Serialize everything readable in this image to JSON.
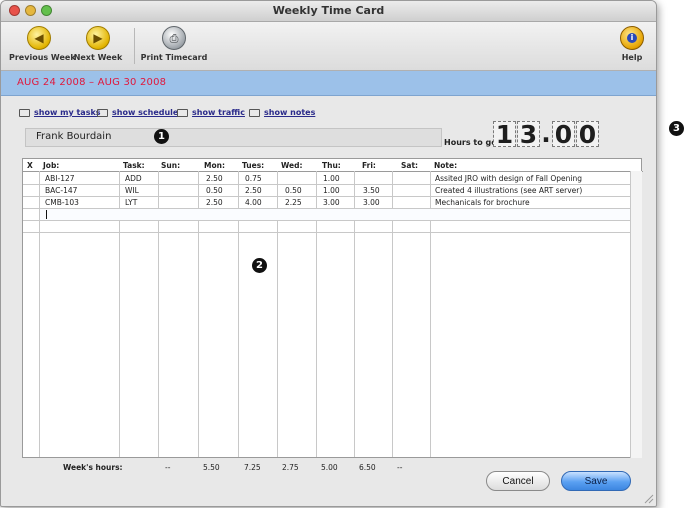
{
  "window": {
    "title": "Weekly Time Card"
  },
  "toolbar": {
    "previous_week": "Previous Week",
    "next_week": "Next Week",
    "print_timecard": "Print Timecard",
    "help": "Help"
  },
  "date_range": "AUG 24 2008 – AUG 30 2008",
  "links": {
    "show_my_tasks": "show my tasks",
    "show_schedule": "show schedule",
    "show_traffic": "show traffic",
    "show_notes": "show notes"
  },
  "employee_name": "Frank Bourdain",
  "hours_to_go": {
    "label": "Hours to go:",
    "digits": [
      "1",
      "3",
      ".",
      "0",
      "0"
    ]
  },
  "callouts": [
    "1",
    "2",
    "3"
  ],
  "table": {
    "headers": [
      "X",
      "Job:",
      "Task:",
      "Sun:",
      "Mon:",
      "Tues:",
      "Wed:",
      "Thu:",
      "Fri:",
      "Sat:",
      "Note:"
    ],
    "rows": [
      {
        "x": "",
        "job": "ABI-127",
        "task": "ADD",
        "sun": "",
        "mon": "2.50",
        "tues": "0.75",
        "wed": "",
        "thu": "1.00",
        "fri": "",
        "sat": "",
        "note": "Assited JRO with design of Fall Opening"
      },
      {
        "x": "",
        "job": "BAC-147",
        "task": "WIL",
        "sun": "",
        "mon": "0.50",
        "tues": "2.50",
        "wed": "0.50",
        "thu": "1.00",
        "fri": "3.50",
        "sat": "",
        "note": "Created 4 illustrations (see ART server)"
      },
      {
        "x": "",
        "job": "CMB-103",
        "task": "LYT",
        "sun": "",
        "mon": "2.50",
        "tues": "4.00",
        "wed": "2.25",
        "thu": "3.00",
        "fri": "3.00",
        "sat": "",
        "note": "Mechanicals for brochure"
      }
    ]
  },
  "weeks_hours": {
    "label": "Week's hours:",
    "sun": "--",
    "mon": "5.50",
    "tues": "7.25",
    "wed": "2.75",
    "thu": "5.00",
    "fri": "6.50",
    "sat": "--"
  },
  "buttons": {
    "cancel": "Cancel",
    "save": "Save"
  },
  "colors": {
    "date_band": "#9cc1e9",
    "date_text": "#e0183c",
    "save_button": "#5aa0f2"
  }
}
